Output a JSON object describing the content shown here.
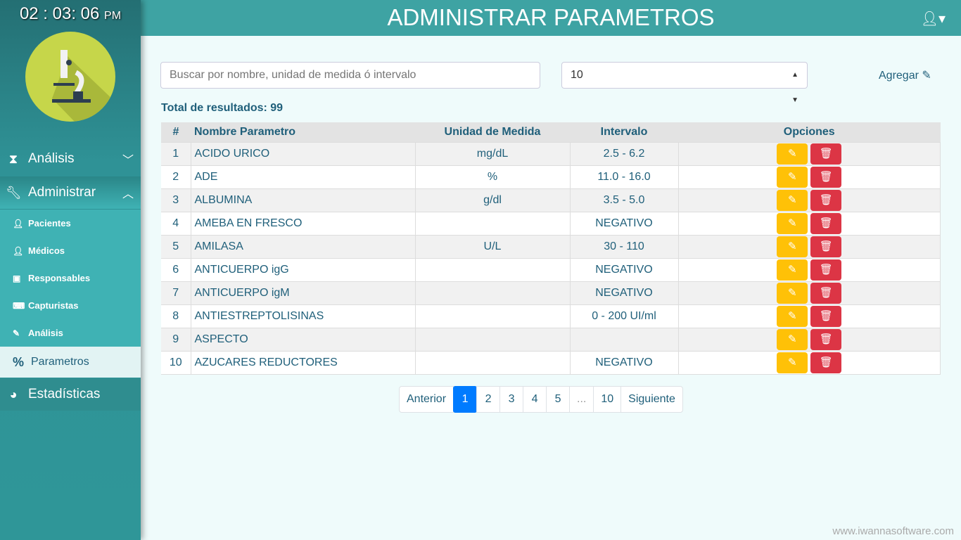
{
  "clock": {
    "time": "02 : 03: 06",
    "ampm": "PM"
  },
  "header": {
    "title": "ADMINISTRAR PARAMETROS"
  },
  "sidebar": {
    "analisis": "Análisis",
    "administrar": "Administrar",
    "estadisticas": "Estadísticas",
    "sub": [
      {
        "label": "Pacientes",
        "icon": "user-icon"
      },
      {
        "label": "Médicos",
        "icon": "doctor-icon"
      },
      {
        "label": "Responsables",
        "icon": "id-card-icon"
      },
      {
        "label": "Capturistas",
        "icon": "keyboard-icon"
      },
      {
        "label": "Análisis",
        "icon": "test-tube-icon"
      },
      {
        "label": "Parametros",
        "icon": "percent-icon"
      }
    ]
  },
  "toolbar": {
    "search_placeholder": "Buscar por nombre, unidad de medida ó intervalo",
    "page_size": "10",
    "add_label": "Agregar"
  },
  "total": "Total de resultados: 99",
  "table": {
    "headers": [
      "#",
      "Nombre Parametro",
      "Unidad de Medida",
      "Intervalo",
      "Opciones"
    ],
    "rows": [
      [
        "1",
        "ACIDO URICO",
        "mg/dL",
        "2.5 - 6.2"
      ],
      [
        "2",
        "ADE",
        "%",
        "11.0 - 16.0"
      ],
      [
        "3",
        "ALBUMINA",
        "g/dl",
        "3.5 - 5.0"
      ],
      [
        "4",
        "AMEBA EN FRESCO",
        "",
        "NEGATIVO"
      ],
      [
        "5",
        "AMILASA",
        "U/L",
        "30 - 110"
      ],
      [
        "6",
        "ANTICUERPO igG",
        "",
        "NEGATIVO"
      ],
      [
        "7",
        "ANTICUERPO igM",
        "",
        "NEGATIVO"
      ],
      [
        "8",
        "ANTIESTREPTOLISINAS",
        "",
        "0 - 200 UI/ml"
      ],
      [
        "9",
        "ASPECTO",
        "",
        ""
      ],
      [
        "10",
        "AZUCARES REDUCTORES",
        "",
        "NEGATIVO"
      ]
    ]
  },
  "pagination": [
    "Anterior",
    "1",
    "2",
    "3",
    "4",
    "5",
    "...",
    "10",
    "Siguiente"
  ],
  "footer": "www.iwannasoftware.com",
  "colors": {
    "accent": "#3ea3a3",
    "edit": "#ffc107",
    "delete": "#dc3545",
    "active_page": "#007bff"
  }
}
